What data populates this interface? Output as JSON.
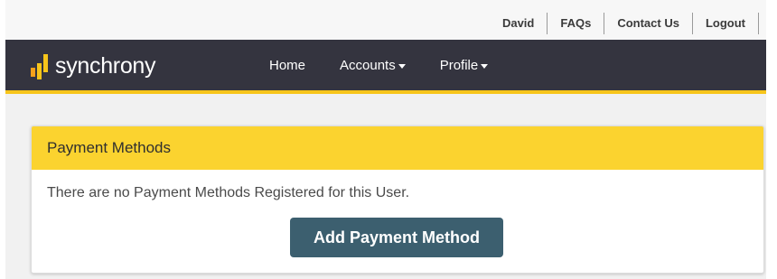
{
  "utility_nav": {
    "items": [
      {
        "label": "David"
      },
      {
        "label": "FAQs"
      },
      {
        "label": "Contact Us"
      },
      {
        "label": "Logout"
      }
    ]
  },
  "brand": {
    "name": "synchrony",
    "colors": {
      "accent": "#f7c51b",
      "nav_background": "#34343f",
      "button": "#3c5f6f"
    }
  },
  "main_nav": {
    "items": [
      {
        "label": "Home",
        "dropdown": false
      },
      {
        "label": "Accounts",
        "dropdown": true
      },
      {
        "label": "Profile",
        "dropdown": true
      }
    ]
  },
  "panel": {
    "title": "Payment Methods",
    "message": "There are no Payment Methods Registered for this User.",
    "button_label": "Add Payment Method"
  }
}
